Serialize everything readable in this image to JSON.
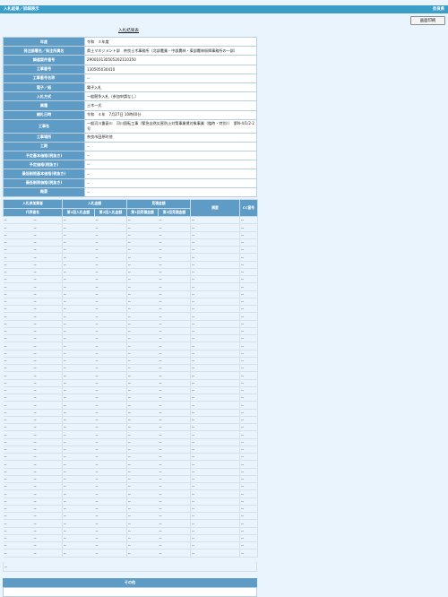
{
  "header": {
    "title": "入札結果／詳細表示",
    "right_text": "奈良県"
  },
  "toolbar": {
    "print_label": "画面印刷"
  },
  "page_title": "入札結果表",
  "info_rows": [
    {
      "label": "年度",
      "value": "令和　３年度"
    },
    {
      "label": "発注部署名／発注所属名",
      "value": "県土マネジメント部　奈良土木事務所（北部農業・中部農林・東部農林振興事務所の一部）"
    },
    {
      "label": "調達案件番号",
      "value": "290010130505202110350"
    },
    {
      "label": "工事番号",
      "value": "130505030410"
    },
    {
      "label": "工事番号名称",
      "value": "--"
    },
    {
      "label": "電子／紙",
      "value": "電子入札"
    },
    {
      "label": "入札方式",
      "value": "一般競争入札（参加申請なし）"
    },
    {
      "label": "業種",
      "value": "土木一式"
    },
    {
      "label": "開札日時",
      "value": "令和　４年　7月27日 10時40分"
    },
    {
      "label": "工事名",
      "value": "一般河川重豪川　河川国転工事（緊急自然災害防止対策事業債対象事業（臨時・特別））　第N-4/1/2-2　号",
      "tall": true
    },
    {
      "label": "工事場所",
      "value": "奈良市田原町他"
    },
    {
      "label": "工期",
      "value": "--"
    },
    {
      "label": "予定基本価格(税抜き)",
      "value": "--"
    },
    {
      "label": "予定価格(税抜き)",
      "value": "--"
    },
    {
      "label": "最低制限基本価格(税抜き)",
      "value": "--"
    },
    {
      "label": "最低制限価格(税抜き)",
      "value": "--"
    },
    {
      "label": "概要",
      "value": "--"
    }
  ],
  "results": {
    "group_headers": {
      "participant": "入札参加業者",
      "bid": "入札金額",
      "nego": "見積金額",
      "remarks": "摘要",
      "cc": "CC番号"
    },
    "sub_headers": {
      "name": "代表者名",
      "bid1": "第1回入札金額",
      "bid2": "第2回入札金額",
      "nego1": "第1回見積金額",
      "nego2": "第2回見積金額"
    },
    "rows": [
      [
        "--",
        "--",
        "--",
        "--",
        "--",
        "--",
        "--",
        "--"
      ],
      [
        "--",
        "--",
        "--",
        "--",
        "--",
        "--",
        "--",
        "--"
      ],
      [
        "--",
        "--",
        "--",
        "--",
        "--",
        "--",
        "--",
        "--"
      ],
      [
        "--",
        "--",
        "--",
        "--",
        "--",
        "--",
        "--",
        "--"
      ],
      [
        "--",
        "--",
        "--",
        "--",
        "--",
        "--",
        "--",
        "--"
      ],
      [
        "--",
        "--",
        "--",
        "--",
        "--",
        "--",
        "--",
        "--"
      ],
      [
        "--",
        "--",
        "--",
        "--",
        "--",
        "--",
        "--",
        "--"
      ],
      [
        "--",
        "--",
        "--",
        "--",
        "--",
        "--",
        "--",
        "--"
      ],
      [
        "--",
        "--",
        "--",
        "--",
        "--",
        "--",
        "--",
        "--"
      ],
      [
        "--",
        "--",
        "--",
        "--",
        "--",
        "--",
        "--",
        "--"
      ],
      [
        "--",
        "--",
        "--",
        "--",
        "--",
        "--",
        "--",
        "--"
      ],
      [
        "--",
        "--",
        "--",
        "--",
        "--",
        "--",
        "--",
        "--"
      ],
      [
        "--",
        "--",
        "--",
        "--",
        "--",
        "--",
        "--",
        "--"
      ],
      [
        "--",
        "--",
        "--",
        "--",
        "--",
        "--",
        "--",
        "--"
      ],
      [
        "--",
        "--",
        "--",
        "--",
        "--",
        "--",
        "--",
        "--"
      ],
      [
        "--",
        "--",
        "--",
        "--",
        "--",
        "--",
        "--",
        "--"
      ],
      [
        "--",
        "--",
        "--",
        "--",
        "--",
        "--",
        "--",
        "--"
      ],
      [
        "--",
        "--",
        "--",
        "--",
        "--",
        "--",
        "--",
        "--"
      ],
      [
        "--",
        "--",
        "--",
        "--",
        "--",
        "--",
        "--",
        "--"
      ],
      [
        "--",
        "--",
        "--",
        "--",
        "--",
        "--",
        "--",
        "--"
      ],
      [
        "--",
        "--",
        "--",
        "--",
        "--",
        "--",
        "--",
        "--"
      ],
      [
        "--",
        "--",
        "--",
        "--",
        "--",
        "--",
        "--",
        "--"
      ],
      [
        "--",
        "--",
        "--",
        "--",
        "--",
        "--",
        "--",
        "--"
      ],
      [
        "--",
        "--",
        "--",
        "--",
        "--",
        "--",
        "--",
        "--"
      ],
      [
        "--",
        "--",
        "--",
        "--",
        "--",
        "--",
        "--",
        "--"
      ],
      [
        "--",
        "--",
        "--",
        "--",
        "--",
        "--",
        "--",
        "--"
      ],
      [
        "--",
        "--",
        "--",
        "--",
        "--",
        "--",
        "--",
        "--"
      ],
      [
        "--",
        "--",
        "--",
        "--",
        "--",
        "--",
        "--",
        "--"
      ],
      [
        "--",
        "--",
        "--",
        "--",
        "--",
        "--",
        "--",
        "--"
      ],
      [
        "--",
        "--",
        "--",
        "--",
        "--",
        "--",
        "--",
        "--"
      ],
      [
        "--",
        "--",
        "--",
        "--",
        "--",
        "--",
        "--",
        "--"
      ],
      [
        "--",
        "--",
        "--",
        "--",
        "--",
        "--",
        "--",
        "--"
      ],
      [
        "--",
        "--",
        "--",
        "--",
        "--",
        "--",
        "--",
        "--"
      ],
      [
        "--",
        "--",
        "--",
        "--",
        "--",
        "--",
        "--",
        "--"
      ],
      [
        "--",
        "--",
        "--",
        "--",
        "--",
        "--",
        "--",
        "--"
      ],
      [
        "--",
        "--",
        "--",
        "--",
        "--",
        "--",
        "--",
        "--"
      ],
      [
        "--",
        "--",
        "--",
        "--",
        "--",
        "--",
        "--",
        "--"
      ],
      [
        "--",
        "--",
        "--",
        "--",
        "--",
        "--",
        "--",
        "--"
      ],
      [
        "--",
        "--",
        "--",
        "--",
        "--",
        "--",
        "--",
        "--"
      ],
      [
        "--",
        "--",
        "--",
        "--",
        "--",
        "--",
        "--",
        "--"
      ],
      [
        "--",
        "--",
        "--",
        "--",
        "--",
        "--",
        "--",
        "--"
      ],
      [
        "--",
        "--",
        "--",
        "--",
        "--",
        "--",
        "--",
        "--"
      ],
      [
        "--",
        "--",
        "--",
        "--",
        "--",
        "--",
        "--",
        "--"
      ],
      [
        "--",
        "--",
        "--",
        "--",
        "--",
        "--",
        "--",
        "--"
      ],
      [
        "--",
        "--",
        "--",
        "--",
        "--",
        "--",
        "--",
        "--"
      ],
      [
        "--",
        "--",
        "--",
        "--",
        "--",
        "--",
        "--",
        "--"
      ]
    ],
    "trailing": "--"
  },
  "other": {
    "title": "その他"
  }
}
